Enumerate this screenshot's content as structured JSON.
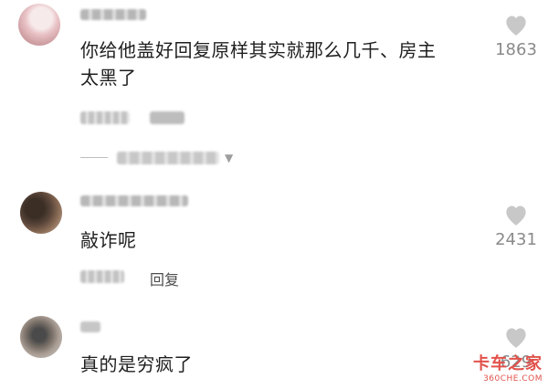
{
  "comments": [
    {
      "text_line1": "你给他盖好回复原样其实就那么几千、房主",
      "text_line2": "太黑了",
      "likes": "1863"
    },
    {
      "text": "敲诈呢",
      "likes": "2431",
      "reply_label": "回复"
    },
    {
      "text": "真的是穷疯了",
      "likes": "629"
    }
  ],
  "watermark": {
    "main": "卡车之家",
    "sub": "360CHE.COM"
  },
  "icons": {
    "avatar": "user-avatar",
    "like": "heart-icon",
    "expand": "caret-down-icon"
  },
  "colors": {
    "like_icon": "#c8c8c8",
    "watermark": "#e2524b"
  }
}
